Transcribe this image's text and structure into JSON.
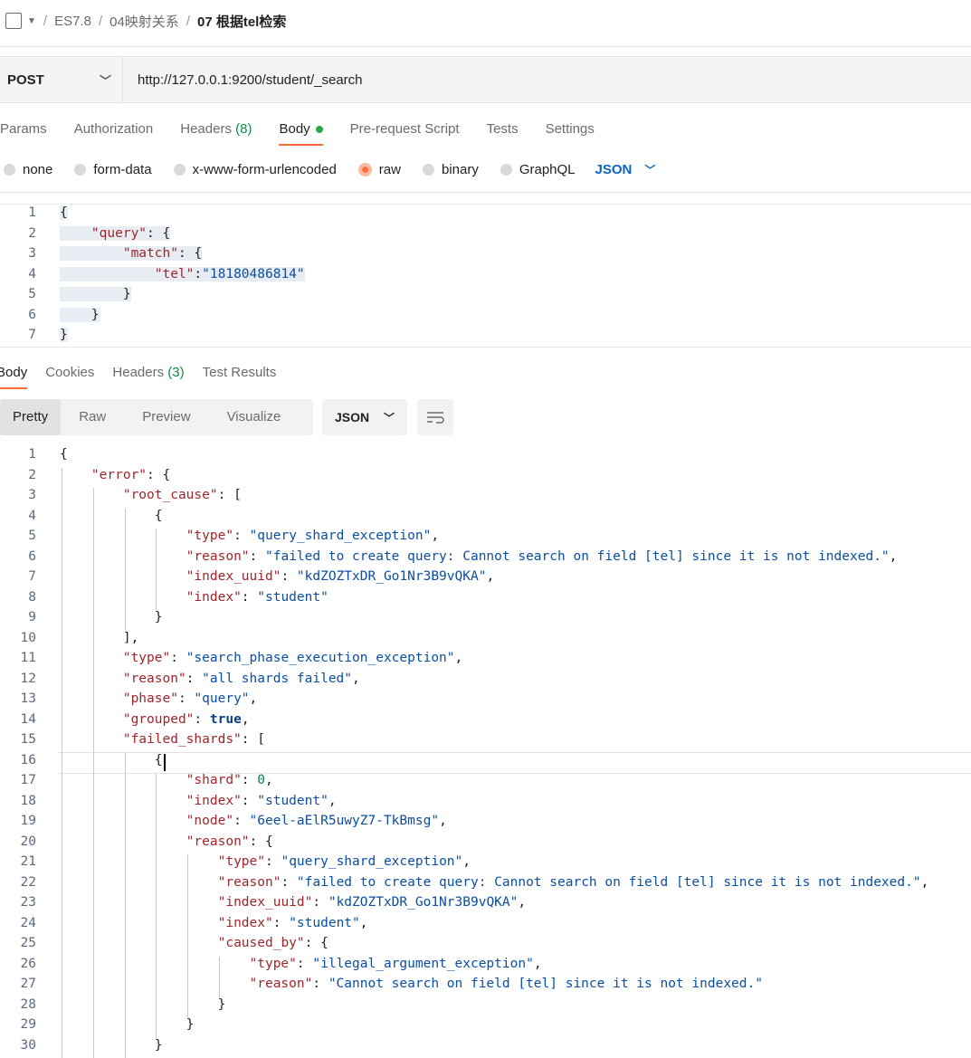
{
  "breadcrumb": [
    "ES7.8",
    "04映射关系",
    "07 根据tel检索"
  ],
  "request": {
    "method": "POST",
    "url": "http://127.0.0.1:9200/student/_search"
  },
  "request_tabs": [
    {
      "label": "Params"
    },
    {
      "label": "Authorization"
    },
    {
      "label": "Headers",
      "count": "(8)"
    },
    {
      "label": "Body",
      "active": true
    },
    {
      "label": "Pre-request Script"
    },
    {
      "label": "Tests"
    },
    {
      "label": "Settings"
    }
  ],
  "body_types": [
    "none",
    "form-data",
    "x-www-form-urlencoded",
    "raw",
    "binary",
    "GraphQL"
  ],
  "body_type_selected": "raw",
  "body_format": "JSON",
  "request_body_lines": [
    "{",
    "    \"query\": {",
    "        \"match\": {",
    "            \"tel\":\"18180486814\"",
    "        }",
    "    }",
    "}"
  ],
  "response_tabs": [
    {
      "label": "Body",
      "active": true
    },
    {
      "label": "Cookies"
    },
    {
      "label": "Headers",
      "count": "(3)"
    },
    {
      "label": "Test Results"
    }
  ],
  "response_formats": [
    "Pretty",
    "Raw",
    "Preview",
    "Visualize"
  ],
  "response_format_selected": "Pretty",
  "response_language": "JSON",
  "response_lines": [
    "{",
    "    \"error\": {",
    "        \"root_cause\": [",
    "            {",
    "                \"type\": \"query_shard_exception\",",
    "                \"reason\": \"failed to create query: Cannot search on field [tel] since it is not indexed.\",",
    "                \"index_uuid\": \"kdZOZTxDR_Go1Nr3B9vQKA\",",
    "                \"index\": \"student\"",
    "            }",
    "        ],",
    "        \"type\": \"search_phase_execution_exception\",",
    "        \"reason\": \"all shards failed\",",
    "        \"phase\": \"query\",",
    "        \"grouped\": true,",
    "        \"failed_shards\": [",
    "            {",
    "                \"shard\": 0,",
    "                \"index\": \"student\",",
    "                \"node\": \"6eel-aElR5uwyZ7-TkBmsg\",",
    "                \"reason\": {",
    "                    \"type\": \"query_shard_exception\",",
    "                    \"reason\": \"failed to create query: Cannot search on field [tel] since it is not indexed.\",",
    "                    \"index_uuid\": \"kdZOZTxDR_Go1Nr3B9vQKA\",",
    "                    \"index\": \"student\",",
    "                    \"caused_by\": {",
    "                        \"type\": \"illegal_argument_exception\",",
    "                        \"reason\": \"Cannot search on field [tel] since it is not indexed.\"",
    "                    }",
    "                }",
    "            }"
  ],
  "colors": {
    "accent": "#ff6c37",
    "key": "#a0252b",
    "string": "#0b4ea2",
    "link": "#0b64c0"
  }
}
